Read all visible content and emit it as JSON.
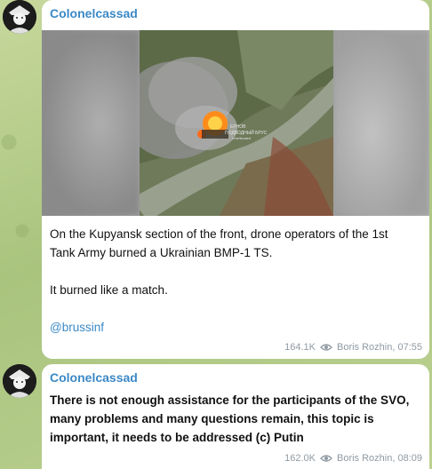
{
  "messages": [
    {
      "sender": "Colonelcassad",
      "media": {
        "watermark_line1": "ЕРНОВ",
        "watermark_line2": "ПОДВОДНЫЙ БРУС",
        "watermark_line3": "t.me/brusinf"
      },
      "text_lines": [
        "On the Kupyansk section of the front, drone operators of the 1st",
        "Tank Army burned a Ukrainian BMP-1 TS."
      ],
      "text_2": "It burned like a match.",
      "link": "@brussinf",
      "views": "164.1K",
      "author_time": "Boris Rozhin, 07:55"
    },
    {
      "sender": "Colonelcassad",
      "text_lines": [
        "There is not enough assistance for the participants of the SVO,",
        "many problems and many questions remain, this topic is",
        "important, it needs to be addressed (c) Putin"
      ],
      "views": "162.0K",
      "author_time": "Boris Rozhin, 08:09"
    }
  ],
  "colors": {
    "sender": "#3b89c6",
    "link": "#3b89c6",
    "meta": "#8f9aa3",
    "bubble": "#ffffff"
  },
  "icons": {
    "avatar": "avatar-icon",
    "views": "eye-icon"
  }
}
